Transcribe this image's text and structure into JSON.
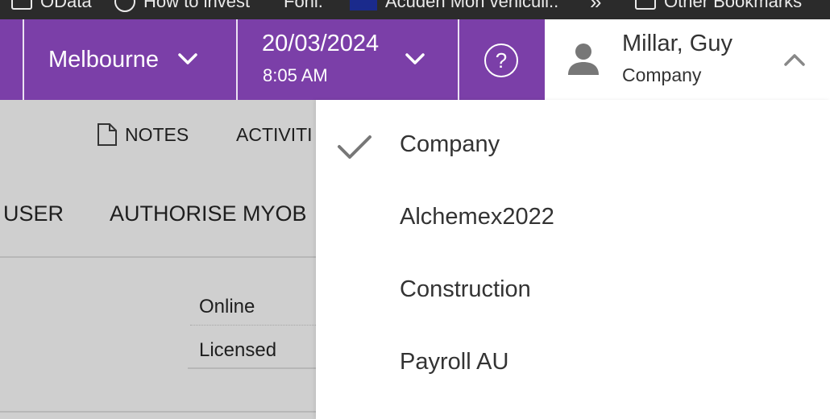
{
  "bookmarks_bar": {
    "items": [
      {
        "label": "OData",
        "icon": "folder-icon"
      },
      {
        "label": "How to invest",
        "icon": "globe-icon"
      },
      {
        "label": "Fonl.",
        "icon": ""
      },
      {
        "label": "Acuden Mon venicull..",
        "icon": "flag-icon"
      },
      {
        "label": "Other Bookmarks",
        "icon": "folder-icon"
      }
    ],
    "overflow_glyph": "»"
  },
  "header": {
    "location": "Melbourne",
    "date": "20/03/2024",
    "time": "8:05 AM",
    "help_glyph": "?"
  },
  "user": {
    "name": "Millar, Guy",
    "company": "Company"
  },
  "background": {
    "notes_label": "NOTES",
    "activities_label": "ACTIVITI",
    "tab_user": "USER",
    "tab_authorise": "AUTHORISE MYOB",
    "status_online": "Online",
    "status_licensed": "Licensed"
  },
  "company_menu": {
    "items": [
      {
        "label": "Company",
        "selected": true
      },
      {
        "label": "Alchemex2022",
        "selected": false
      },
      {
        "label": "Construction",
        "selected": false
      },
      {
        "label": "Payroll AU",
        "selected": false
      }
    ]
  },
  "colors": {
    "header_purple": "#7b3fa8",
    "overlay_gray": "#cfcfcf",
    "check_gray": "#777777"
  }
}
